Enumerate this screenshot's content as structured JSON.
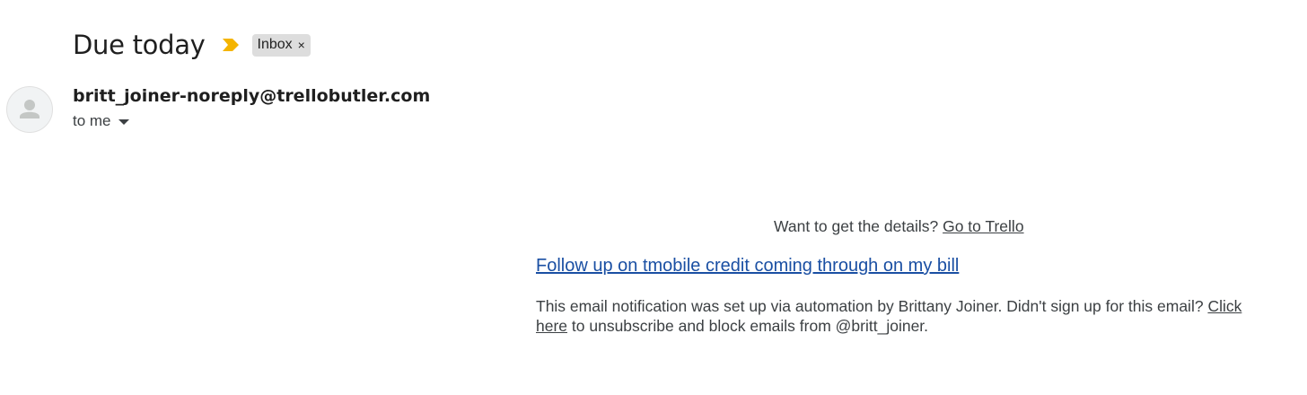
{
  "email": {
    "subject": "Due today",
    "importance_icon": "importance-marker-icon",
    "label": {
      "text": "Inbox",
      "close_glyph": "×"
    },
    "sender": "britt_joiner-noreply@trellobutler.com",
    "recipient_text": "to me",
    "avatar_icon": "default-person-icon"
  },
  "body": {
    "details_prefix": "Want to get the details?",
    "details_link": "Go to Trello",
    "card_link": "Follow up on tmobile credit coming through on my bill",
    "footer_prefix": "This email notification was set up via automation by Brittany Joiner. Didn't sign up for this email?",
    "footer_link": "Click here",
    "footer_suffix": "to unsubscribe and block emails from @britt_joiner."
  },
  "colors": {
    "importance": "#f4b400",
    "card_link": "#1a4fa3",
    "label_bg": "#dddddd"
  }
}
